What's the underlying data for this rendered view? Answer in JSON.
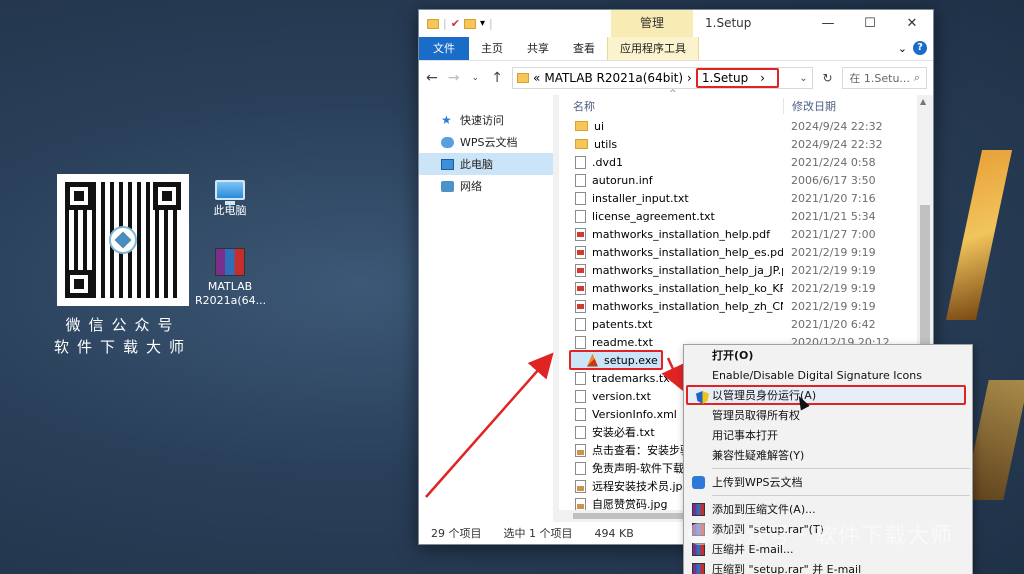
{
  "desktop": {
    "qr_caption_1": "微信公众号",
    "qr_caption_2": "软件下载大师",
    "icons": [
      {
        "label": "此电脑"
      },
      {
        "label": "MATLAB R2021a(64..."
      }
    ]
  },
  "window": {
    "manage_tab": "管理",
    "title": "1.Setup",
    "controls": {
      "minimize": "—",
      "maximize": "☐",
      "close": "✕"
    },
    "ribbon_tabs": [
      "文件",
      "主页",
      "共享",
      "查看",
      "应用程序工具"
    ],
    "address": {
      "prefix": "«",
      "crumb_parent": "MATLAB R2021a(64bit)",
      "crumb_current": "1.Setup",
      "sep": "›"
    },
    "search_placeholder": "在 1.Setu...",
    "nav": [
      {
        "label": "快速访问",
        "icon": "star-icon"
      },
      {
        "label": "WPS云文档",
        "icon": "cloud-icon"
      },
      {
        "label": "此电脑",
        "icon": "pc-icon"
      },
      {
        "label": "网络",
        "icon": "network-icon"
      }
    ],
    "columns": {
      "name": "名称",
      "date": "修改日期"
    },
    "files": [
      {
        "name": "ui",
        "date": "2024/9/24 22:32",
        "type": "folder"
      },
      {
        "name": "utils",
        "date": "2024/9/24 22:32",
        "type": "folder"
      },
      {
        "name": ".dvd1",
        "date": "2021/2/24 0:58",
        "type": "doc"
      },
      {
        "name": "autorun.inf",
        "date": "2006/6/17 3:50",
        "type": "doc"
      },
      {
        "name": "installer_input.txt",
        "date": "2021/1/20 7:16",
        "type": "doc"
      },
      {
        "name": "license_agreement.txt",
        "date": "2021/1/21 5:34",
        "type": "doc"
      },
      {
        "name": "mathworks_installation_help.pdf",
        "date": "2021/1/27 7:00",
        "type": "pdf"
      },
      {
        "name": "mathworks_installation_help_es.pdf",
        "date": "2021/2/19 9:19",
        "type": "pdf"
      },
      {
        "name": "mathworks_installation_help_ja_JP.pdf",
        "date": "2021/2/19 9:19",
        "type": "pdf"
      },
      {
        "name": "mathworks_installation_help_ko_KR.pdf",
        "date": "2021/2/19 9:19",
        "type": "pdf"
      },
      {
        "name": "mathworks_installation_help_zh_CN.pdf",
        "date": "2021/2/19 9:19",
        "type": "pdf"
      },
      {
        "name": "patents.txt",
        "date": "2021/1/20 6:42",
        "type": "doc"
      },
      {
        "name": "readme.txt",
        "date": "2020/12/19 20:12",
        "type": "doc"
      },
      {
        "name": "setup.exe",
        "date": "",
        "type": "exe"
      },
      {
        "name": "trademarks.txt",
        "date": "",
        "type": "doc"
      },
      {
        "name": "version.txt",
        "date": "",
        "type": "doc"
      },
      {
        "name": "VersionInfo.xml",
        "date": "",
        "type": "doc"
      },
      {
        "name": "安装必看.txt",
        "date": "",
        "type": "doc"
      },
      {
        "name": "点击查看：安装步骤",
        "date": "",
        "type": "jpg"
      },
      {
        "name": "免责声明-软件下载大",
        "date": "",
        "type": "doc"
      },
      {
        "name": "远程安装技术员.jpg",
        "date": "",
        "type": "jpg"
      },
      {
        "name": "自愿赞赏码.jpg",
        "date": "",
        "type": "jpg"
      }
    ],
    "status": {
      "count": "29 个项目",
      "selected": "选中 1 个项目",
      "size": "494 KB"
    }
  },
  "context_menu": {
    "items": [
      {
        "label": "打开(O)",
        "bold": true
      },
      {
        "label": "Enable/Disable Digital Signature Icons"
      },
      {
        "label": "以管理员身份运行(A)",
        "icon": "shield-icon",
        "highlight": true
      },
      {
        "label": "管理员取得所有权"
      },
      {
        "label": "用记事本打开"
      },
      {
        "label": "兼容性疑难解答(Y)"
      },
      {
        "sep": true
      },
      {
        "label": "上传到WPS云文档",
        "icon": "wps-icon"
      },
      {
        "sep": true
      },
      {
        "label": "添加到压缩文件(A)...",
        "icon": "rar-icon"
      },
      {
        "label": "添加到 \"setup.rar\"(T)",
        "icon": "rar-icon"
      },
      {
        "label": "压缩并 E-mail...",
        "icon": "rar-icon"
      },
      {
        "label": "压缩到 \"setup.rar\" 并 E-mail",
        "icon": "rar-icon"
      }
    ]
  },
  "watermark": "公众号 · 软件下载大师",
  "colors": {
    "highlight_red": "#e02424",
    "file_tab": "#1a6cc9",
    "selection": "#cce4f7",
    "manage_tab": "#f8ecb4"
  }
}
